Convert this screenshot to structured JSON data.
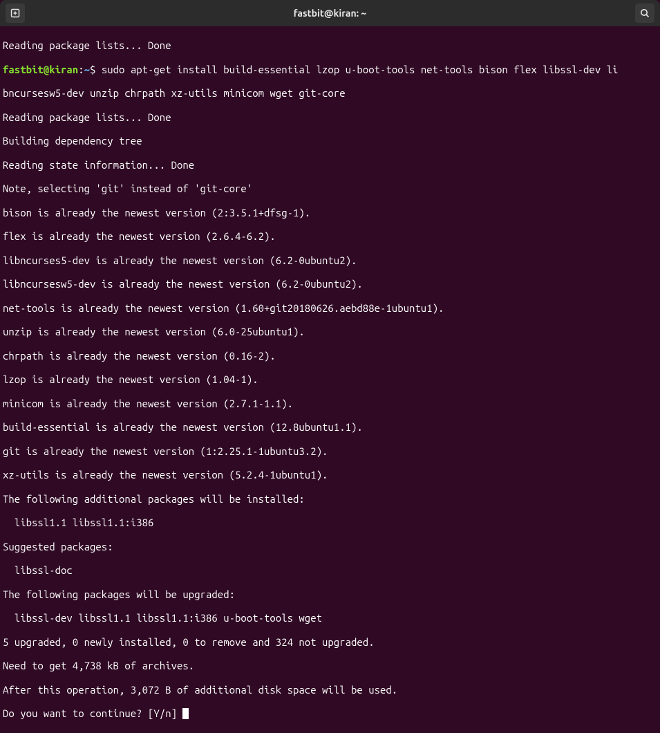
{
  "titlebar": {
    "title": "fastbit@kiran: ~"
  },
  "prompt": {
    "user_host": "fastbit@kiran",
    "colon": ":",
    "path": "~",
    "dollar": "$"
  },
  "lines": {
    "l0": "Reading package lists... Done",
    "cmd": " sudo apt-get install build-essential lzop u-boot-tools net-tools bison flex libssl-dev li",
    "l2": "bncursesw5-dev unzip chrpath xz-utils minicom wget git-core",
    "l3": "Reading package lists... Done",
    "l4": "Building dependency tree",
    "l5": "Reading state information... Done",
    "l6": "Note, selecting 'git' instead of 'git-core'",
    "l7": "bison is already the newest version (2:3.5.1+dfsg-1).",
    "l8": "flex is already the newest version (2.6.4-6.2).",
    "l9": "libncurses5-dev is already the newest version (6.2-0ubuntu2).",
    "l10": "libncursesw5-dev is already the newest version (6.2-0ubuntu2).",
    "l11": "net-tools is already the newest version (1.60+git20180626.aebd88e-1ubuntu1).",
    "l12": "unzip is already the newest version (6.0-25ubuntu1).",
    "l13": "chrpath is already the newest version (0.16-2).",
    "l14": "lzop is already the newest version (1.04-1).",
    "l15": "minicom is already the newest version (2.7.1-1.1).",
    "l16": "build-essential is already the newest version (12.8ubuntu1.1).",
    "l17": "git is already the newest version (1:2.25.1-1ubuntu3.2).",
    "l18": "xz-utils is already the newest version (5.2.4-1ubuntu1).",
    "l19": "The following additional packages will be installed:",
    "l20": "  libssl1.1 libssl1.1:i386",
    "l21": "Suggested packages:",
    "l22": "  libssl-doc",
    "l23": "The following packages will be upgraded:",
    "l24": "  libssl-dev libssl1.1 libssl1.1:i386 u-boot-tools wget",
    "l25": "5 upgraded, 0 newly installed, 0 to remove and 324 not upgraded.",
    "l26": "Need to get 4,738 kB of archives.",
    "l27": "After this operation, 3,072 B of additional disk space will be used.",
    "l28": "Do you want to continue? [Y/n] "
  }
}
